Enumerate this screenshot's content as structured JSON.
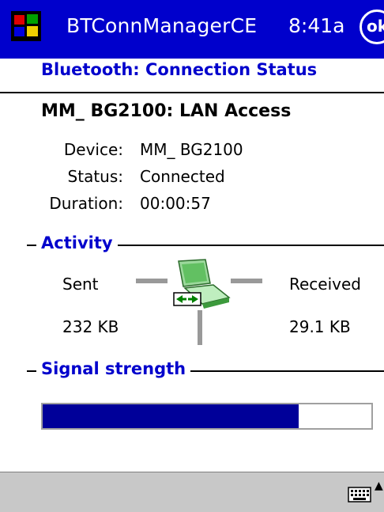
{
  "titlebar": {
    "app_title": "BTConnManagerCE",
    "clock": "8:41a",
    "ok_label": "ok"
  },
  "header": {
    "title": "Bluetooth: Connection Status"
  },
  "connection": {
    "name": "MM_ BG2100: LAN Access",
    "fields": [
      {
        "label": "Device:",
        "value": "MM_ BG2100"
      },
      {
        "label": "Status:",
        "value": "Connected"
      },
      {
        "label": "Duration:",
        "value": "00:00:57"
      }
    ]
  },
  "activity": {
    "title": "Activity",
    "sent_label": "Sent",
    "received_label": "Received",
    "sent_value": "232 KB",
    "received_value": "29.1 KB"
  },
  "signal": {
    "title": "Signal strength",
    "level_fraction": 0.78,
    "fill_color": "#000099"
  },
  "icons": [
    "windows-flag-icon",
    "network-computer-icon",
    "keyboard-icon"
  ]
}
